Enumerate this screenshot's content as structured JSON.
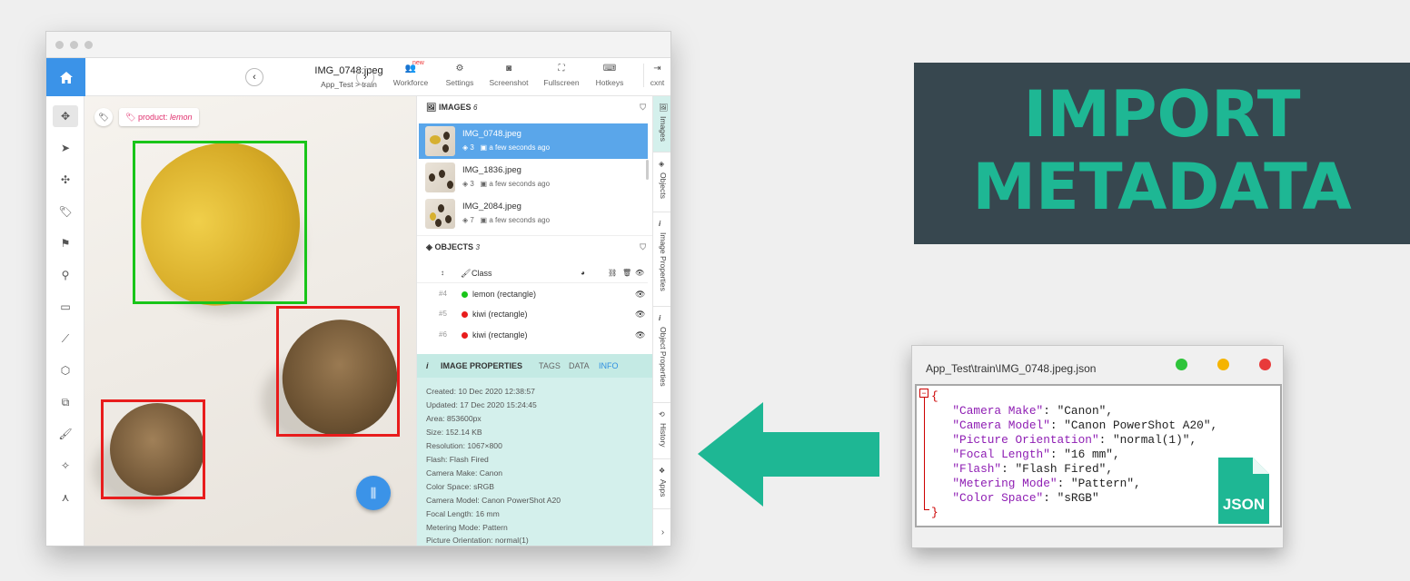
{
  "window": {
    "file_name": "IMG_0748.jpeg",
    "breadcrumb": "App_Test > train",
    "prev": "‹",
    "next": "›",
    "toolbar": [
      {
        "label": "Workforce",
        "icon": "users-icon"
      },
      {
        "label": "Settings",
        "icon": "gear-icon"
      },
      {
        "label": "Screenshot",
        "icon": "camera-icon"
      },
      {
        "label": "Fullscreen",
        "icon": "fullscreen-icon"
      },
      {
        "label": "Hotkeys",
        "icon": "keyboard-icon"
      },
      {
        "label": "cxnt",
        "icon": "logout-icon"
      }
    ],
    "new_badge": "new"
  },
  "canvas": {
    "tag_label": "product:",
    "tag_value": "lemon"
  },
  "images": {
    "title": "IMAGES",
    "count": "6",
    "items": [
      {
        "name": "IMG_0748.jpeg",
        "objects": "3",
        "time": "a few seconds ago",
        "selected": true
      },
      {
        "name": "IMG_1836.jpeg",
        "objects": "3",
        "time": "a few seconds ago",
        "selected": false
      },
      {
        "name": "IMG_2084.jpeg",
        "objects": "7",
        "time": "a few seconds ago",
        "selected": false
      }
    ]
  },
  "objects": {
    "title": "OBJECTS",
    "count": "3",
    "class_header": "Class",
    "items": [
      {
        "num": "#4",
        "label": "lemon (rectangle)",
        "color": "#19c519"
      },
      {
        "num": "#5",
        "label": "kiwi (rectangle)",
        "color": "#e81c1c"
      },
      {
        "num": "#6",
        "label": "kiwi (rectangle)",
        "color": "#e81c1c"
      }
    ]
  },
  "image_properties": {
    "title": "IMAGE PROPERTIES",
    "tabs": [
      "TAGS",
      "DATA",
      "INFO"
    ],
    "active_tab": "INFO",
    "lines": [
      "Created: 10 Dec 2020 12:38:57",
      "Updated: 17 Dec 2020 15:24:45",
      "Area: 853600px",
      "Size: 152.14 KB",
      "Resolution: 1067×800",
      "Flash: Flash Fired",
      "Camera Make: Canon",
      "Color Space: sRGB",
      "Camera Model: Canon PowerShot A20",
      "Focal Length: 16 mm",
      "Metering Mode: Pattern",
      "Picture Orientation: normal(1)"
    ]
  },
  "side_tabs": [
    "Images",
    "Objects",
    "Image Properties",
    "Object Properties",
    "History",
    "Apps"
  ],
  "banner": {
    "line1": "IMPORT",
    "line2": "METADATA"
  },
  "json_window": {
    "title": "App_Test\\train\\IMG_0748.jpeg.json",
    "open_brace": "{",
    "close_brace": "}",
    "fold_marker": "−",
    "entries": [
      {
        "key": "\"Camera Make\"",
        "value": "\"Canon\","
      },
      {
        "key": "\"Camera Model\"",
        "value": "\"Canon PowerShot A20\","
      },
      {
        "key": "\"Picture Orientation\"",
        "value": "\"normal(1)\","
      },
      {
        "key": "\"Focal Length\"",
        "value": "\"16 mm\","
      },
      {
        "key": "\"Flash\"",
        "value": "\"Flash Fired\","
      },
      {
        "key": "\"Metering Mode\"",
        "value": "\"Pattern\","
      },
      {
        "key": "\"Color Space\"",
        "value": "\"sRGB\""
      }
    ],
    "icon_label": "JSON",
    "dot_colors": [
      "#2ec43a",
      "#f5b400",
      "#e83b3b"
    ]
  },
  "colors": {
    "accent": "#3b93e8",
    "teal": "#1eb794",
    "banner_bg": "#37474f",
    "lemon_box": "#19c519",
    "kiwi_box": "#e81c1c"
  }
}
